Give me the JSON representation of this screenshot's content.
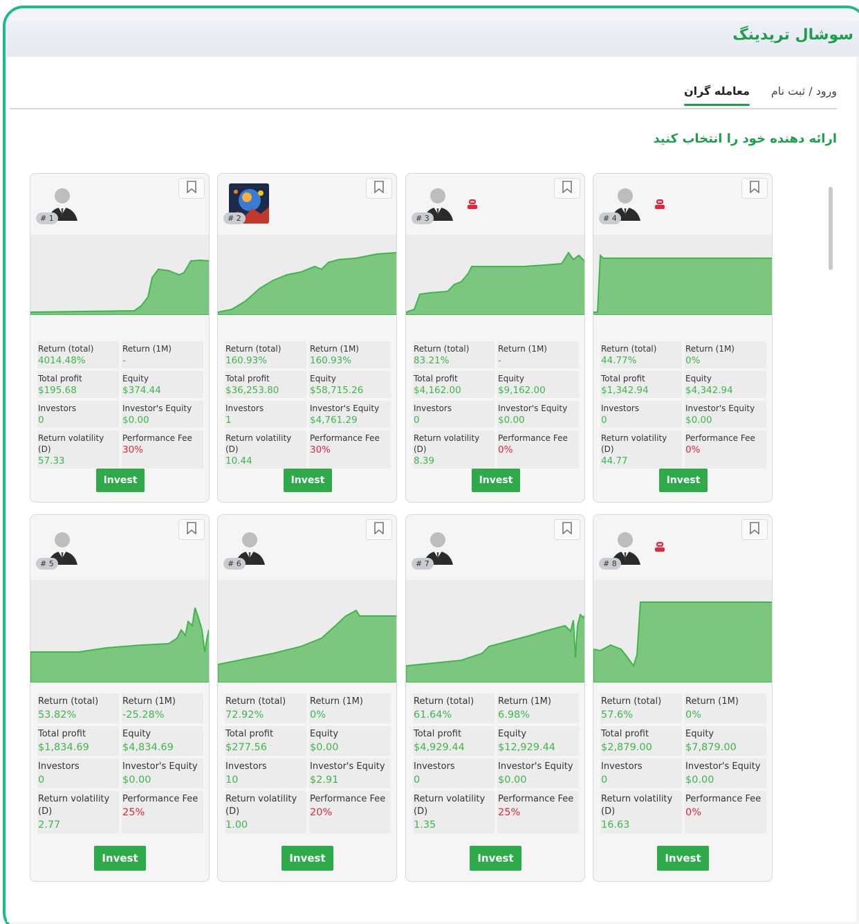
{
  "app": {
    "title": "سوشال تریدینگ"
  },
  "tabs": {
    "login": "ورود / ثبت نام",
    "traders": "معامله گران"
  },
  "section_title": "ارائه دهنده خود را انتخاب کنید",
  "labels": {
    "return_total": "Return (total)",
    "return_1m": "Return (1M)",
    "total_profit": "Total profit",
    "equity": "Equity",
    "investors": "Investors",
    "investors_equity": "Investor's Equity",
    "return_volatility": "Return volatility (D)",
    "performance_fee": "Performance Fee",
    "invest": "Invest"
  },
  "colors": {
    "accent": "#2eaa4a",
    "positive": "#3cb84a",
    "negative": "#e3263b",
    "chart_fill": "#7dc67f",
    "chart_line": "#3cb84a"
  },
  "traders": [
    {
      "rank": "# 1",
      "avatar": "person-icon",
      "robot": false,
      "return_total": "4014.48%",
      "return_1m": "-",
      "total_profit": "$195.68",
      "equity": "$374.44",
      "investors": "0",
      "investors_equity": "$0.00",
      "return_volatility": "57.33",
      "performance_fee": "30%"
    },
    {
      "rank": "# 2",
      "avatar": "photo",
      "robot": false,
      "return_total": "160.93%",
      "return_1m": "160.93%",
      "total_profit": "$36,253.80",
      "equity": "$58,715.26",
      "investors": "1",
      "investors_equity": "$4,761.29",
      "return_volatility": "10.44",
      "performance_fee": "30%"
    },
    {
      "rank": "# 3",
      "avatar": "person-icon",
      "robot": true,
      "return_total": "83.21%",
      "return_1m": "-",
      "total_profit": "$4,162.00",
      "equity": "$9,162.00",
      "investors": "0",
      "investors_equity": "$0.00",
      "return_volatility": "8.39",
      "performance_fee": "0%"
    },
    {
      "rank": "# 4",
      "avatar": "person-icon",
      "robot": true,
      "return_total": "44.77%",
      "return_1m": "0%",
      "total_profit": "$1,342.94",
      "equity": "$4,342.94",
      "investors": "0",
      "investors_equity": "$0.00",
      "return_volatility": "44.77",
      "performance_fee": "0%"
    },
    {
      "rank": "# 5",
      "avatar": "person-icon",
      "robot": false,
      "return_total": "53.82%",
      "return_1m": "-25.28%",
      "total_profit": "$1,834.69",
      "equity": "$4,834.69",
      "investors": "0",
      "investors_equity": "$0.00",
      "return_volatility": "2.77",
      "performance_fee": "25%"
    },
    {
      "rank": "# 6",
      "avatar": "person-icon",
      "robot": false,
      "return_total": "72.92%",
      "return_1m": "0%",
      "total_profit": "$277.56",
      "equity": "$0.00",
      "investors": "10",
      "investors_equity": "$2.91",
      "return_volatility": "1.00",
      "performance_fee": "20%"
    },
    {
      "rank": "# 7",
      "avatar": "person-icon",
      "robot": false,
      "return_total": "61.64%",
      "return_1m": "6.98%",
      "total_profit": "$4,929.44",
      "equity": "$12,929.44",
      "investors": "0",
      "investors_equity": "$0.00",
      "return_volatility": "1.35",
      "performance_fee": "25%"
    },
    {
      "rank": "# 8",
      "avatar": "person-icon",
      "robot": true,
      "return_total": "57.6%",
      "return_1m": "0%",
      "total_profit": "$2,879.00",
      "equity": "$7,879.00",
      "investors": "0",
      "investors_equity": "$0.00",
      "return_volatility": "16.63",
      "performance_fee": "0%"
    }
  ]
}
